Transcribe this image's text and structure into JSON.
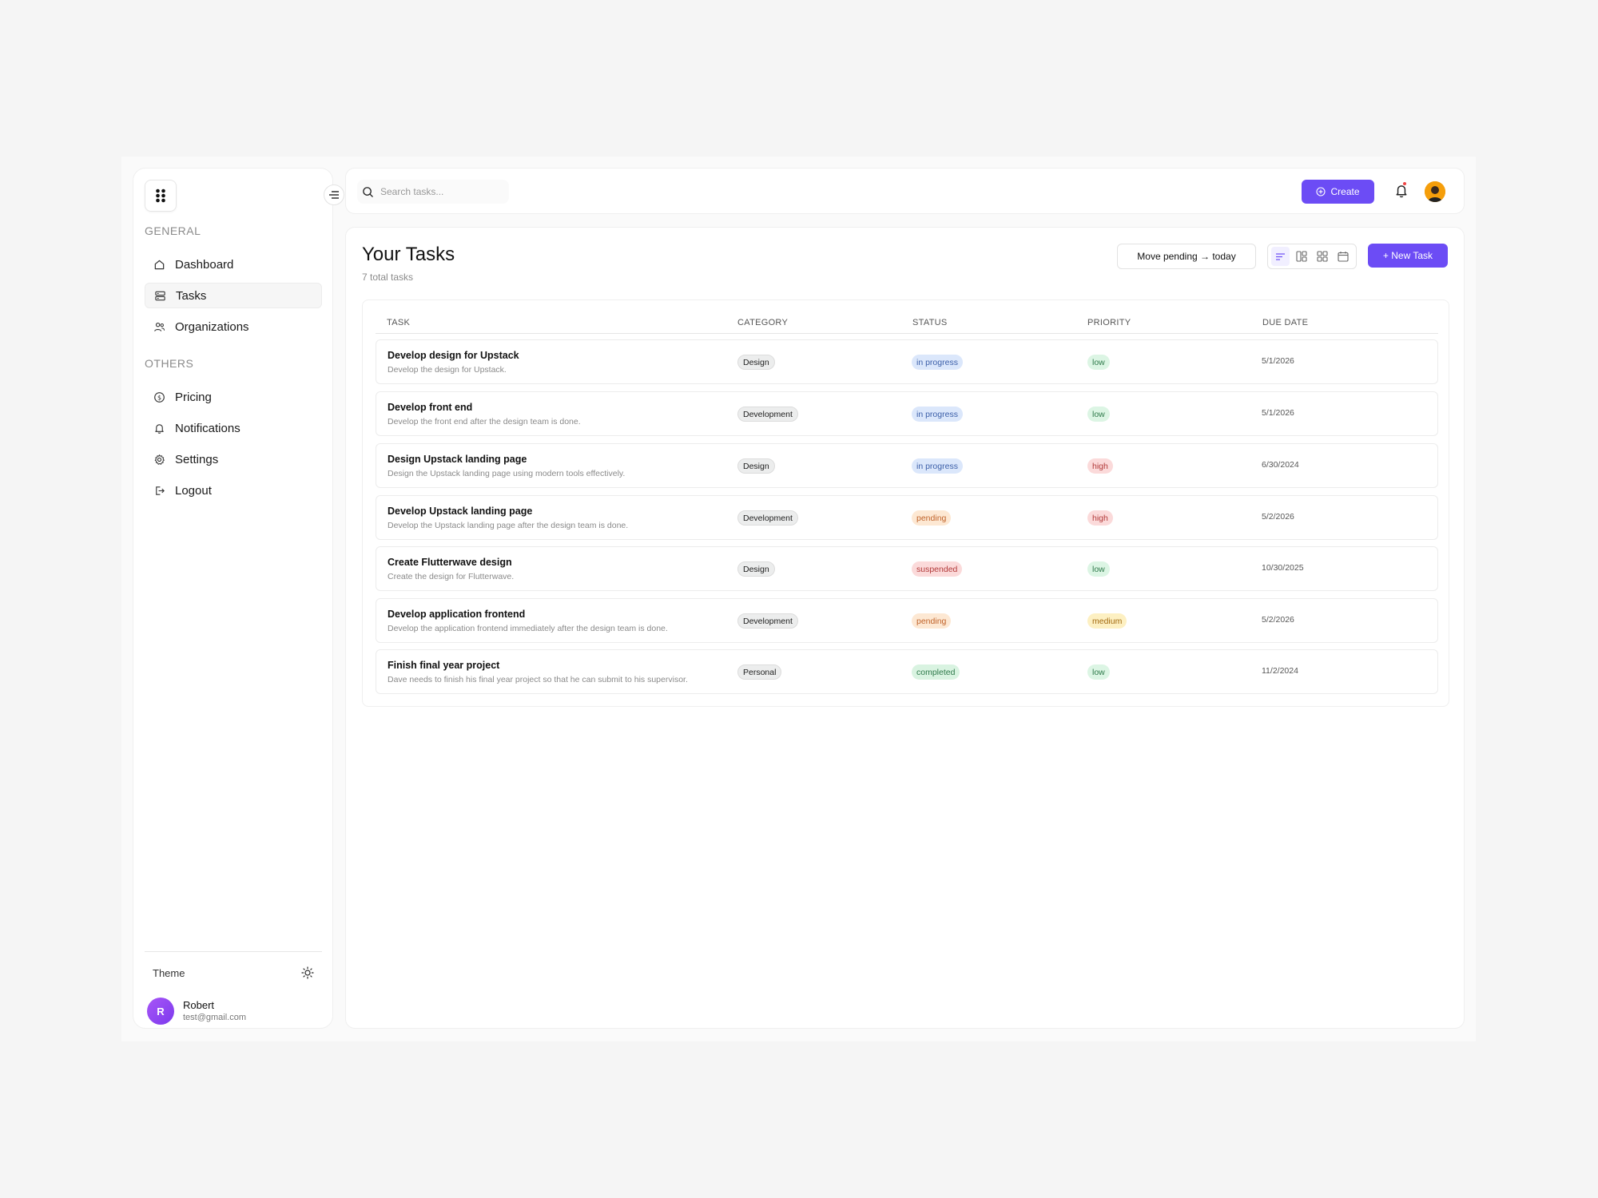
{
  "sidebar": {
    "general_label": "GENERAL",
    "others_label": "OTHERS",
    "general_items": [
      {
        "label": "Dashboard",
        "icon": "home-icon",
        "active": false
      },
      {
        "label": "Tasks",
        "icon": "tasks-icon",
        "active": true
      },
      {
        "label": "Organizations",
        "icon": "users-icon",
        "active": false
      }
    ],
    "other_items": [
      {
        "label": "Pricing",
        "icon": "dollar-icon"
      },
      {
        "label": "Notifications",
        "icon": "bell-icon"
      },
      {
        "label": "Settings",
        "icon": "gear-icon"
      },
      {
        "label": "Logout",
        "icon": "logout-icon"
      }
    ],
    "theme_label": "Theme",
    "user": {
      "initial": "R",
      "name": "Robert",
      "email": "test@gmail.com"
    }
  },
  "topbar": {
    "search_placeholder": "Search tasks...",
    "create_label": "Create"
  },
  "main": {
    "title": "Your Tasks",
    "subtitle": "7 total tasks",
    "move_label": "Move pending → today",
    "new_task_label": "+ New Task",
    "columns": [
      "TASK",
      "CATEGORY",
      "STATUS",
      "PRIORITY",
      "DUE DATE"
    ],
    "tasks": [
      {
        "title": "Develop design for Upstack",
        "desc": "Develop the design for Upstack.",
        "category": "Design",
        "status": "in progress",
        "priority": "low",
        "due": "5/1/2026"
      },
      {
        "title": "Develop front end",
        "desc": "Develop the front end after the design team is done.",
        "category": "Development",
        "status": "in progress",
        "priority": "low",
        "due": "5/1/2026"
      },
      {
        "title": "Design Upstack landing page",
        "desc": "Design the Upstack landing page using modern tools effectively.",
        "category": "Design",
        "status": "in progress",
        "priority": "high",
        "due": "6/30/2024"
      },
      {
        "title": "Develop Upstack landing page",
        "desc": "Develop the Upstack landing page after the design team is done.",
        "category": "Development",
        "status": "pending",
        "priority": "high",
        "due": "5/2/2026"
      },
      {
        "title": "Create Flutterwave design",
        "desc": "Create the design for Flutterwave.",
        "category": "Design",
        "status": "suspended",
        "priority": "low",
        "due": "10/30/2025"
      },
      {
        "title": "Develop application frontend",
        "desc": "Develop the application frontend immediately after the design team is done.",
        "category": "Development",
        "status": "pending",
        "priority": "medium",
        "due": "5/2/2026"
      },
      {
        "title": "Finish final year project",
        "desc": "Dave needs to finish his final year project so that he can submit to his supervisor.",
        "category": "Personal",
        "status": "completed",
        "priority": "low",
        "due": "11/2/2024"
      }
    ]
  },
  "colors": {
    "accent": "#6c4cf5"
  }
}
